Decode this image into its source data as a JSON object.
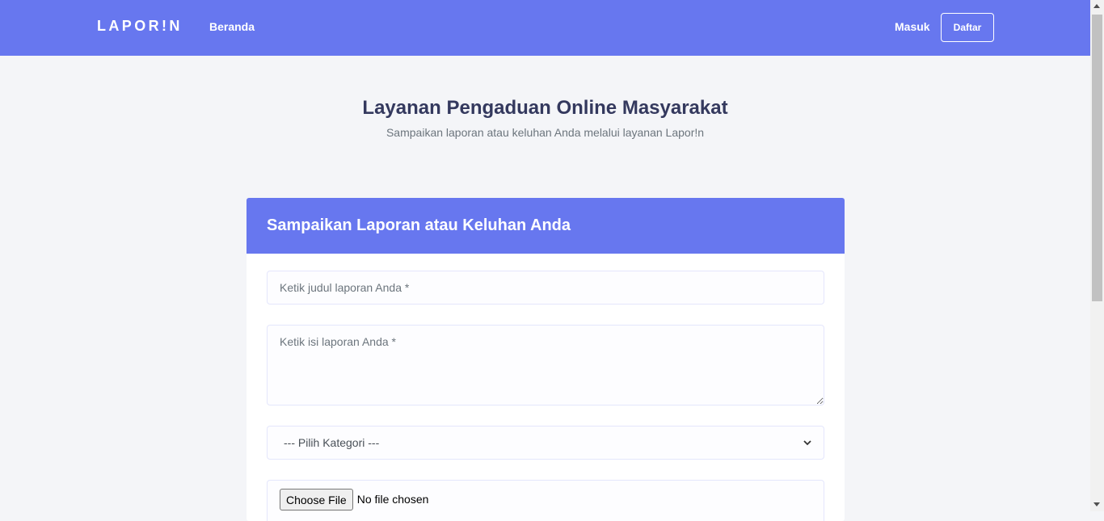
{
  "navbar": {
    "brand": "LAPOR!N",
    "links": [
      {
        "label": "Beranda"
      }
    ],
    "login_label": "Masuk",
    "register_label": "Daftar"
  },
  "hero": {
    "title": "Layanan Pengaduan Online Masyarakat",
    "subtitle": "Sampaikan laporan atau keluhan Anda melalui layanan Lapor!n"
  },
  "form": {
    "header": "Sampaikan Laporan atau Keluhan Anda",
    "title_placeholder": "Ketik judul laporan Anda *",
    "title_value": "",
    "body_placeholder": "Ketik isi laporan Anda *",
    "body_value": "",
    "category_selected": "--- Pilih Kategori ---",
    "file_button": "Choose File",
    "file_status": "No file chosen"
  },
  "colors": {
    "primary": "#6777ef",
    "background": "#f4f5f8"
  }
}
